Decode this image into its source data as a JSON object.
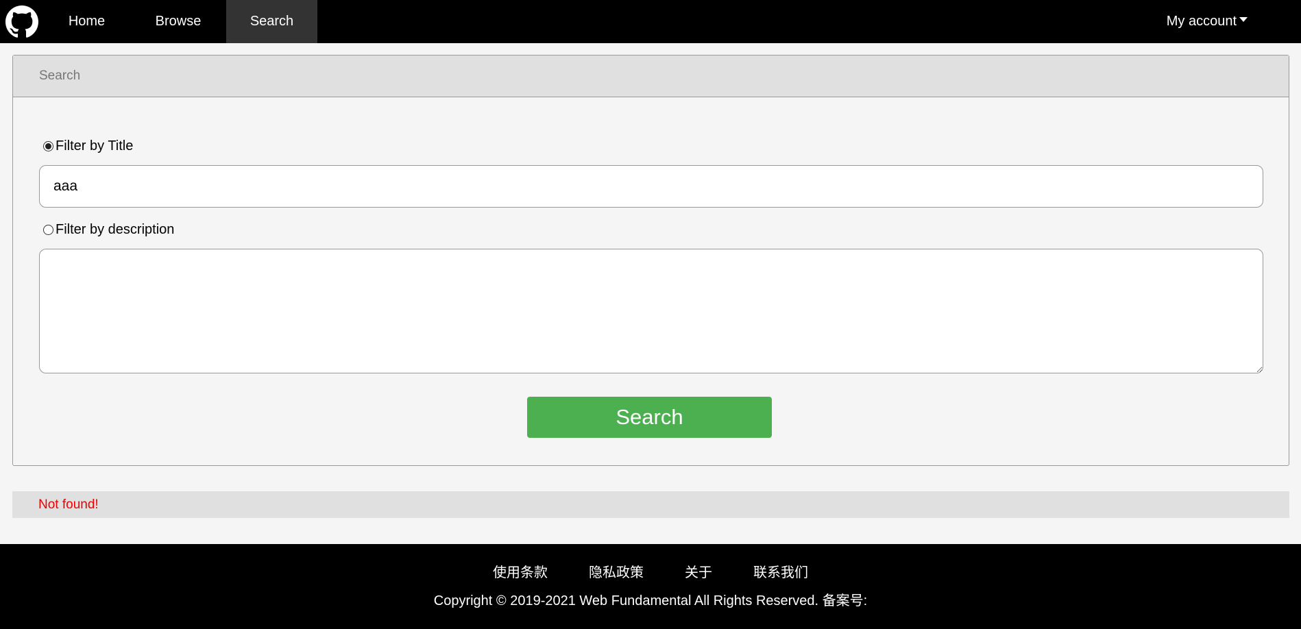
{
  "navbar": {
    "logo_icon": "github-octocat-icon",
    "items": [
      {
        "label": "Home"
      },
      {
        "label": "Browse"
      },
      {
        "label": "Search",
        "active": true
      }
    ],
    "account_label": "My account"
  },
  "panel": {
    "heading": "Search",
    "filter_title_label": "Filter by Title",
    "filter_title_checked": true,
    "title_value": "aaa",
    "filter_description_label": "Filter by description",
    "filter_description_checked": false,
    "description_value": "",
    "search_button_label": "Search"
  },
  "result": {
    "message": "Not found!",
    "color": "#ee0000"
  },
  "footer": {
    "links": [
      {
        "label": "使用条款"
      },
      {
        "label": "隐私政策"
      },
      {
        "label": "关于"
      },
      {
        "label": "联系我们"
      }
    ],
    "copyright": "Copyright © 2019-2021 Web Fundamental All Rights Reserved. 备案号:"
  },
  "colors": {
    "navbar_bg": "#000000",
    "active_tab_bg": "#333333",
    "search_button": "#4caf50",
    "error_text": "#ee0000"
  }
}
